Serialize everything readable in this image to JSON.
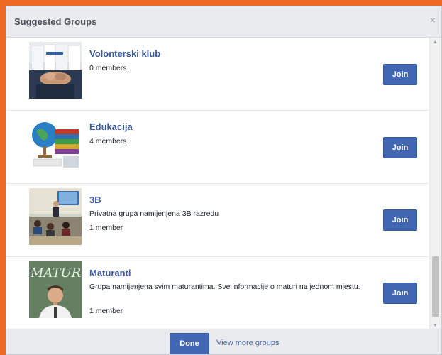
{
  "dialog": {
    "title": "Suggested Groups",
    "close_glyph": "×"
  },
  "groups": [
    {
      "name": "Volonterski klub",
      "description": "",
      "members": "0 members",
      "join_label": "Join",
      "image": "volunteers-hands-photo"
    },
    {
      "name": "Edukacija",
      "description": "",
      "members": "4 members",
      "join_label": "Join",
      "image": "globe-books-photo"
    },
    {
      "name": "3B",
      "description": "Privatna grupa namijenjena 3B razredu",
      "members": "1 member",
      "join_label": "Join",
      "image": "classroom-photo"
    },
    {
      "name": "Maturanti",
      "description": "Grupa namijenjena svim maturantima. Sve informacije o maturi na jednom mjestu.",
      "members": "1 member",
      "join_label": "Join",
      "image": "matura-chalkboard-photo"
    }
  ],
  "footer": {
    "done_label": "Done",
    "more_label": "View more groups"
  },
  "colors": {
    "frame": "#ee6a24",
    "button": "#4267b2",
    "link": "#3b5998",
    "header_bg": "#eaebef"
  }
}
